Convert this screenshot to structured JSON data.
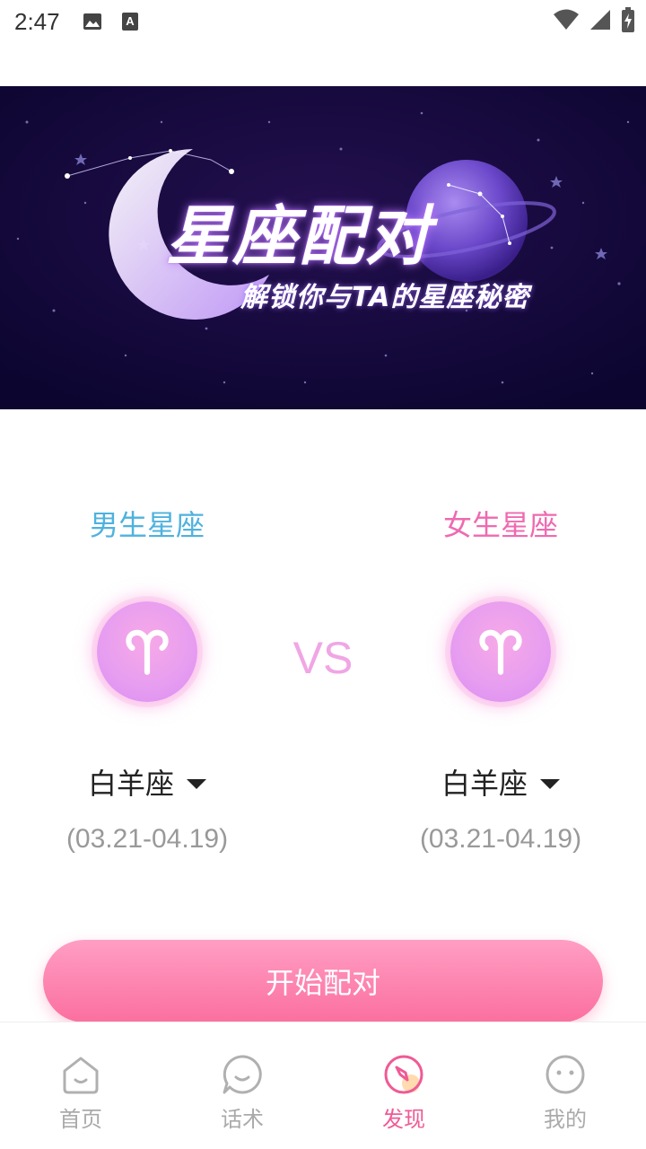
{
  "status_bar": {
    "time": "2:47",
    "left_icons": [
      "image-icon",
      "a-text-icon"
    ],
    "right_icons": [
      "wifi-icon",
      "signal-icon",
      "battery-charging-icon"
    ]
  },
  "banner": {
    "title": "星座配对",
    "subtitle": "解锁你与TA的星座秘密"
  },
  "male": {
    "heading": "男生星座",
    "sign_icon": "aries-icon",
    "sign_name": "白羊座",
    "date_range": "(03.21-04.19)"
  },
  "female": {
    "heading": "女生星座",
    "sign_icon": "aries-icon",
    "sign_name": "白羊座",
    "date_range": "(03.21-04.19)"
  },
  "vs_label": "VS",
  "start_button_label": "开始配对",
  "bottom_nav": {
    "items": [
      {
        "label": "首页",
        "icon": "home-face-icon",
        "active": false
      },
      {
        "label": "话术",
        "icon": "chat-bubble-icon",
        "active": false
      },
      {
        "label": "发现",
        "icon": "compass-icon",
        "active": true
      },
      {
        "label": "我的",
        "icon": "profile-face-icon",
        "active": false
      }
    ]
  },
  "colors": {
    "male_accent": "#4fb2de",
    "female_accent": "#ef6ab0",
    "button_pink": "#fb6f9f",
    "nav_active": "#f05a95",
    "banner_bg": "#14073d"
  }
}
